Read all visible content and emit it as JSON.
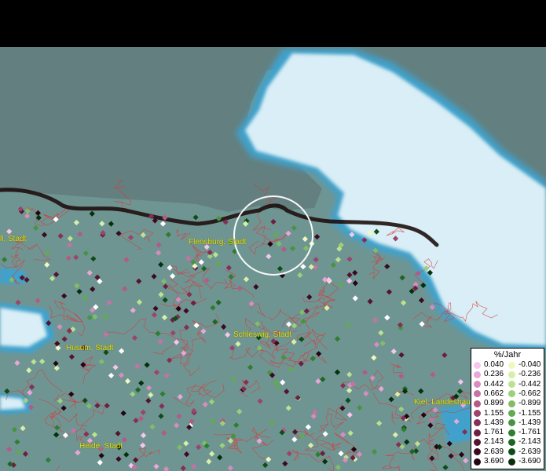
{
  "places": [
    {
      "id": "kiel-stadt-left",
      "label": "ll, Stadt"
    },
    {
      "id": "flensburg",
      "label": "Flensburg, Stadt"
    },
    {
      "id": "husum",
      "label": "Husum, Stadt"
    },
    {
      "id": "schleswig",
      "label": "Schleswig, Stadt"
    },
    {
      "id": "kiel",
      "label": "Kiel, Landeshau"
    },
    {
      "id": "heide",
      "label": "Heide, Stadt"
    }
  ],
  "legend": {
    "title": "%/Jahr",
    "positive": [
      {
        "label": "0.040",
        "color": "#f6c6ec"
      },
      {
        "label": "0.236",
        "color": "#eaa6d8"
      },
      {
        "label": "0.442",
        "color": "#d88cc0"
      },
      {
        "label": "0.662",
        "color": "#c672a4"
      },
      {
        "label": "0.899",
        "color": "#b25a88"
      },
      {
        "label": "1.155",
        "color": "#9c446c"
      },
      {
        "label": "1.439",
        "color": "#843054"
      },
      {
        "label": "1.761",
        "color": "#6c2040"
      },
      {
        "label": "2.143",
        "color": "#541430"
      },
      {
        "label": "2.639",
        "color": "#3c0a20"
      },
      {
        "label": "3.690",
        "color": "#220412"
      }
    ],
    "negative": [
      {
        "label": "-0.040",
        "color": "#eef8c0"
      },
      {
        "label": "-0.236",
        "color": "#d6f0a8"
      },
      {
        "label": "-0.442",
        "color": "#bce290"
      },
      {
        "label": "-0.662",
        "color": "#9ed07a"
      },
      {
        "label": "-0.899",
        "color": "#80be66"
      },
      {
        "label": "-1.155",
        "color": "#62aa52"
      },
      {
        "label": "-1.439",
        "color": "#469440"
      },
      {
        "label": "-1.761",
        "color": "#2e7e30"
      },
      {
        "label": "-2.143",
        "color": "#1c6622"
      },
      {
        "label": "-2.639",
        "color": "#0e4c16"
      },
      {
        "label": "-3.690",
        "color": "#04300a"
      }
    ]
  },
  "colors": {
    "land": "#6f9593",
    "land_north": "#607f7e",
    "sea": "#d7eef6",
    "coast": "#3fa2cc",
    "border": "#1e1010",
    "district_lines": "#d73a3a",
    "highlight_ring": "#ffffff"
  }
}
